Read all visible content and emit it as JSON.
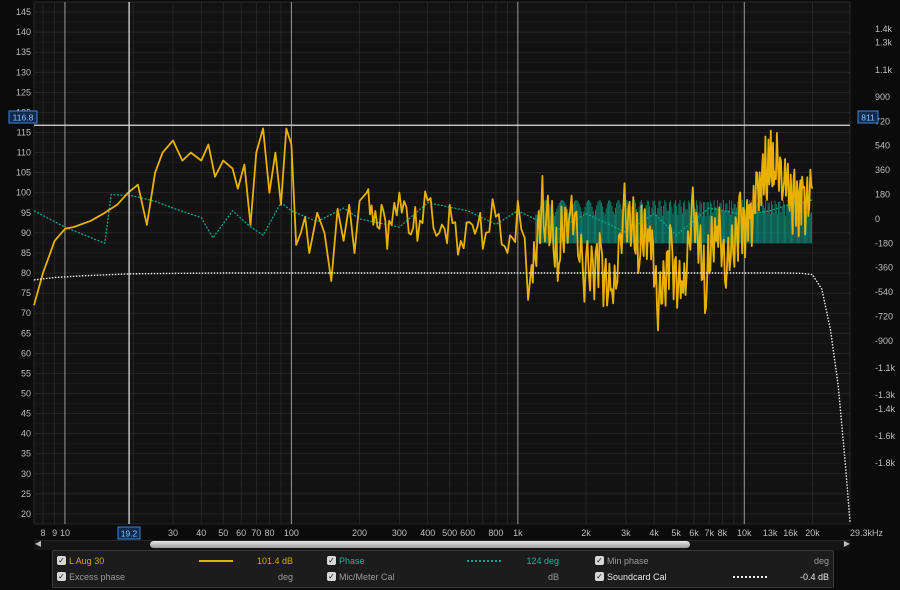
{
  "colors": {
    "background": "#0b0b0b",
    "grid": "#2d2d2d",
    "measurement": "#e8b100",
    "phase": "#0aa58a",
    "min_phase": "#eeeeee",
    "cursor": "#dcdcdc",
    "cursor_label": "#3f86d8"
  },
  "axes": {
    "left_ticks": [
      "145",
      "140",
      "135",
      "130",
      "125",
      "120",
      "115",
      "110",
      "105",
      "100",
      "95",
      "90",
      "85",
      "80",
      "75",
      "70",
      "65",
      "60",
      "55",
      "50",
      "45",
      "40",
      "35",
      "30",
      "25",
      "20"
    ],
    "right_ticks": [
      "1.4k",
      "1.3k",
      "1.1k",
      "900",
      "720",
      "540",
      "360",
      "180",
      "0",
      "-180",
      "-360",
      "-540",
      "-720",
      "-900",
      "-1.1k",
      "-1.3k",
      "-1.4k",
      "-1.6k",
      "-1.8k"
    ],
    "x_ticks": [
      "8",
      "9",
      "10",
      "30",
      "40",
      "50",
      "60",
      "70",
      "80",
      "100",
      "200",
      "300",
      "400",
      "500",
      "600",
      "800",
      "1k",
      "2k",
      "3k",
      "4k",
      "5k",
      "6k",
      "7k",
      "8k",
      "10k",
      "13k",
      "16k",
      "20k",
      "29.3kHz"
    ],
    "y_cursor_label": "116.8",
    "y_cursor_right_label": "811",
    "x_cursor_label": "19.2"
  },
  "legend": {
    "row1": [
      {
        "name": "L Aug 30",
        "value": "101.4 dB",
        "checked": true,
        "style": "measurement"
      },
      {
        "name": "Phase",
        "value": "124 deg",
        "checked": true,
        "style": "phase"
      },
      {
        "name": "Min phase",
        "value": "deg",
        "checked": true,
        "style": "none"
      }
    ],
    "row2": [
      {
        "name": "Excess phase",
        "value": "deg",
        "checked": true,
        "style": "none"
      },
      {
        "name": "Mic/Meter Cal",
        "value": "dB",
        "checked": true,
        "style": "none"
      },
      {
        "name": "Soundcard Cal",
        "value": "-0.4 dB",
        "checked": true,
        "style": "soundcard"
      }
    ]
  },
  "chart_data": {
    "type": "line",
    "x_scale": "log",
    "xlim": [
      7.3,
      29300
    ],
    "ylim": [
      17.5,
      147.5
    ],
    "y_right_lim": [
      -2250,
      1600
    ],
    "grid": true,
    "series": [
      {
        "name": "L Aug 30",
        "unit": "dB",
        "x": [
          7.3,
          8,
          9,
          10,
          11,
          13,
          15,
          17,
          19,
          21,
          23,
          25,
          27,
          30,
          33,
          36,
          40,
          43,
          46,
          50,
          55,
          58,
          62,
          66,
          70,
          75,
          80,
          85,
          90,
          95,
          100,
          105,
          110,
          115,
          120,
          130,
          140,
          150,
          160,
          170,
          180,
          190,
          200,
          215,
          230,
          250,
          270,
          300,
          330,
          360,
          400,
          450,
          500,
          560,
          630,
          700,
          800,
          900,
          1000,
          1150,
          1300,
          1500,
          1700,
          2000,
          2300,
          2600,
          3000,
          3400,
          3800,
          4200,
          4700,
          5300,
          6000,
          6700,
          7500,
          8400,
          9500,
          10500,
          11500,
          12500,
          13500,
          15000,
          16500,
          18000,
          20000
        ],
        "y": [
          72,
          80,
          88,
          91,
          91.5,
          93,
          95,
          97,
          100,
          102,
          92,
          105,
          110,
          113,
          108,
          110,
          108,
          112,
          104,
          108,
          106,
          101,
          107,
          92,
          110,
          116,
          100,
          110,
          97,
          116,
          112,
          87,
          90,
          94,
          85,
          95,
          90,
          78,
          96,
          88,
          97,
          85,
          98,
          100,
          92,
          97,
          93,
          100,
          90,
          88,
          98,
          90,
          97,
          88,
          92,
          86,
          94,
          85,
          98,
          82,
          92,
          78,
          95,
          84,
          90,
          76,
          93,
          80,
          88,
          74,
          92,
          78,
          95,
          70,
          88,
          82,
          99,
          97,
          101,
          100,
          102,
          103,
          103,
          104,
          101
        ]
      },
      {
        "name": "Phase",
        "unit": "deg",
        "x": [
          7.3,
          10,
          15,
          16,
          20,
          25,
          30,
          40,
          45,
          55,
          65,
          75,
          90,
          100,
          130,
          170,
          200,
          300,
          400,
          600,
          800,
          1000,
          1500,
          2000,
          3000,
          4000,
          5000,
          7000,
          10000,
          13000,
          16000,
          20000
        ],
        "y": [
          60,
          -60,
          -180,
          180,
          170,
          130,
          80,
          10,
          -140,
          60,
          -50,
          -120,
          120,
          60,
          -20,
          80,
          0,
          -60,
          120,
          60,
          -40,
          60,
          -80,
          40,
          -100,
          40,
          -120,
          80,
          30,
          60,
          110,
          140
        ]
      },
      {
        "name": "Soundcard Cal",
        "unit": "dB",
        "x": [
          7.3,
          9,
          12,
          16,
          20,
          30,
          50,
          100,
          300,
          1000,
          5000,
          15000,
          18000,
          20000,
          22000,
          24000,
          26000,
          28000,
          29300
        ],
        "y": [
          78.3,
          78.9,
          79.3,
          79.6,
          79.8,
          79.9,
          80,
          80,
          80,
          80,
          80,
          80,
          79.9,
          79.6,
          76,
          66,
          52,
          32,
          18
        ]
      }
    ]
  }
}
